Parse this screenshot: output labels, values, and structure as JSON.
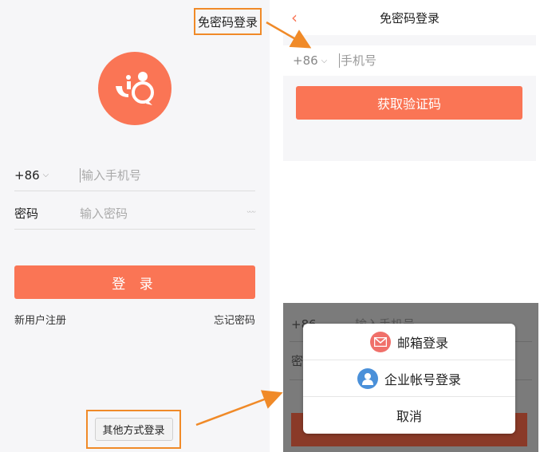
{
  "left": {
    "top_link": "免密码登录",
    "country_code": "+86",
    "phone_placeholder": "输入手机号",
    "password_label": "密码",
    "password_placeholder": "输入密码",
    "login_button": "登 录",
    "register_link": "新用户注册",
    "forgot_link": "忘记密码",
    "other_login_button": "其他方式登录"
  },
  "passwordless": {
    "title": "免密码登录",
    "back_icon": "chevron-left-icon",
    "country_code": "+86",
    "phone_placeholder": "手机号",
    "get_code_button": "获取验证码"
  },
  "other_login_sheet": {
    "background_partial": {
      "code": "+86",
      "phone_hint": "输入手机号",
      "password_char": "密"
    },
    "options": [
      {
        "icon": "mail-icon",
        "label": "邮箱登录",
        "color": "#f0706a"
      },
      {
        "icon": "user-icon",
        "label": "企业帐号登录",
        "color": "#4a90d9"
      }
    ],
    "cancel": "取消"
  },
  "colors": {
    "accent": "#fa7555",
    "highlight_border": "#f08a28",
    "arrow": "#f08a28"
  }
}
